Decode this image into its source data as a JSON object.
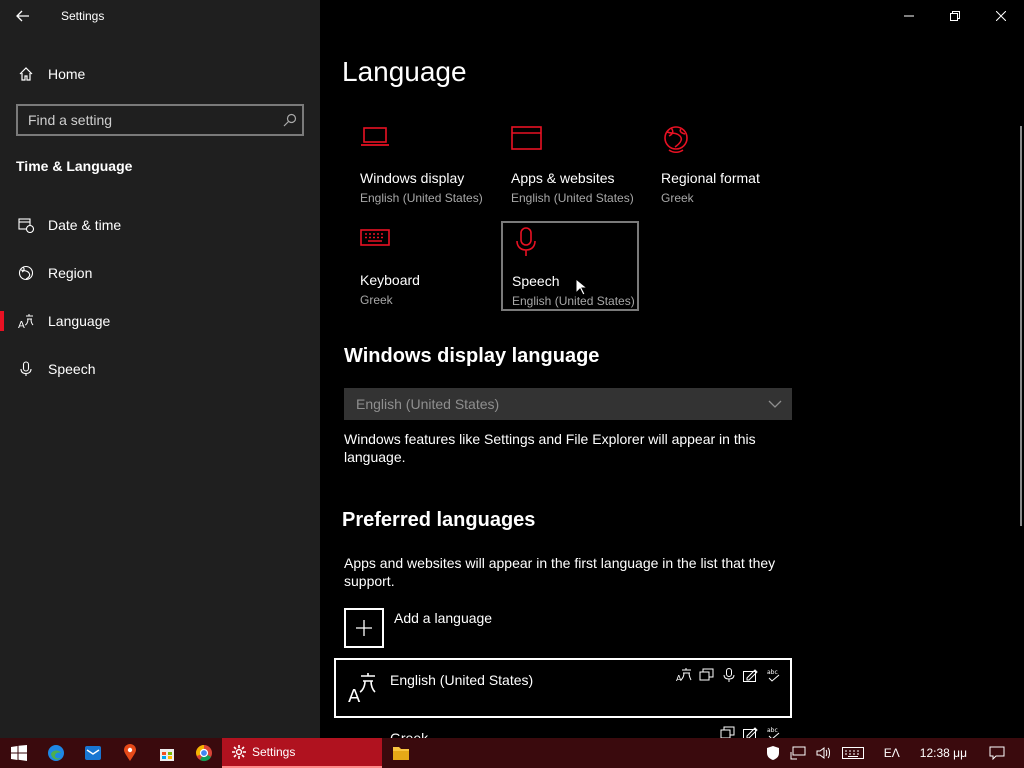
{
  "window": {
    "app_title": "Settings"
  },
  "sidebar": {
    "home_label": "Home",
    "search_placeholder": "Find a setting",
    "section_title": "Time & Language",
    "items": [
      {
        "label": "Date & time",
        "icon": "calendar-clock-icon"
      },
      {
        "label": "Region",
        "icon": "globe-icon"
      },
      {
        "label": "Language",
        "icon": "language-icon",
        "active": true
      },
      {
        "label": "Speech",
        "icon": "microphone-icon"
      }
    ]
  },
  "main": {
    "title": "Language",
    "tiles": [
      {
        "name": "Windows display",
        "sub": "English (United States)",
        "icon": "laptop-icon"
      },
      {
        "name": "Apps & websites",
        "sub": "English (United States)",
        "icon": "browser-window-icon"
      },
      {
        "name": "Regional format",
        "sub": "Greek",
        "icon": "globe-icon"
      },
      {
        "name": "Keyboard",
        "sub": "Greek",
        "icon": "keyboard-icon"
      },
      {
        "name": "Speech",
        "sub": "English (United States)",
        "icon": "microphone-icon",
        "focused": true
      }
    ],
    "display_language_heading": "Windows display language",
    "display_language_value": "English (United States)",
    "display_language_note": "Windows features like Settings and File Explorer will appear in this language.",
    "preferred_heading": "Preferred languages",
    "preferred_note": "Apps and websites will appear in the first language in the list that they support.",
    "add_language_label": "Add a language",
    "languages": [
      {
        "name": "English (United States)",
        "features": [
          "display-language-icon",
          "text-to-speech-icon",
          "speech-recognition-icon",
          "handwriting-icon",
          "spellcheck-icon"
        ]
      },
      {
        "name": "Greek",
        "features": [
          "text-to-speech-icon",
          "handwriting-icon",
          "spellcheck-icon"
        ]
      }
    ]
  },
  "taskbar": {
    "settings_label": "Settings",
    "input_language": "ΕΛ",
    "clock": "12:38 μμ"
  },
  "colors": {
    "accent": "#e81123",
    "taskbar": "#3a0a0d",
    "taskbar_active": "#b0121f"
  }
}
